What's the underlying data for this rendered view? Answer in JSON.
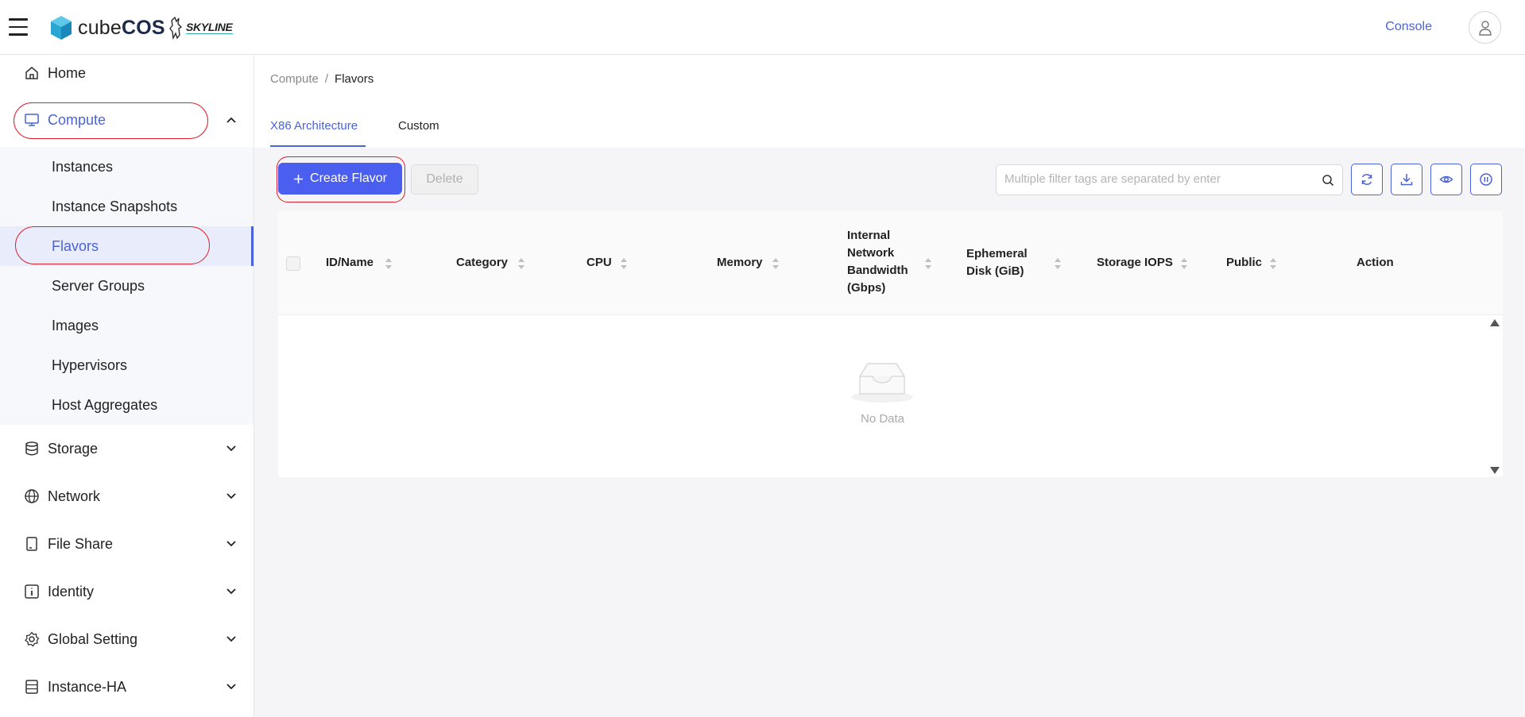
{
  "header": {
    "brand_prefix": "cube",
    "brand_suffix": "COS",
    "partner": "SKYLINE",
    "console_label": "Console"
  },
  "sidebar": {
    "home": "Home",
    "compute": "Compute",
    "compute_items": [
      "Instances",
      "Instance Snapshots",
      "Flavors",
      "Server Groups",
      "Images",
      "Hypervisors",
      "Host Aggregates"
    ],
    "storage": "Storage",
    "network": "Network",
    "file_share": "File Share",
    "identity": "Identity",
    "global_setting": "Global Setting",
    "instance_ha": "Instance-HA"
  },
  "breadcrumb": {
    "parent": "Compute",
    "separator": "/",
    "current": "Flavors"
  },
  "tabs": [
    {
      "label": "X86 Architecture",
      "active": true
    },
    {
      "label": "Custom",
      "active": false
    }
  ],
  "toolbar": {
    "create_label": "Create Flavor",
    "delete_label": "Delete",
    "search_placeholder": "Multiple filter tags are separated by enter"
  },
  "table": {
    "columns": {
      "id_name": "ID/Name",
      "category": "Category",
      "cpu": "CPU",
      "memory": "Memory",
      "bandwidth": [
        "Internal",
        "Network",
        "Bandwidth",
        "(Gbps)"
      ],
      "ephemeral": [
        "Ephemeral",
        "Disk (GiB)"
      ],
      "storage_iops": "Storage IOPS",
      "public": "Public",
      "action": "Action"
    },
    "empty_text": "No Data"
  },
  "colors": {
    "accent": "#4a63d8",
    "primary_button": "#4a5ef0",
    "highlight": "#e01e2c"
  }
}
